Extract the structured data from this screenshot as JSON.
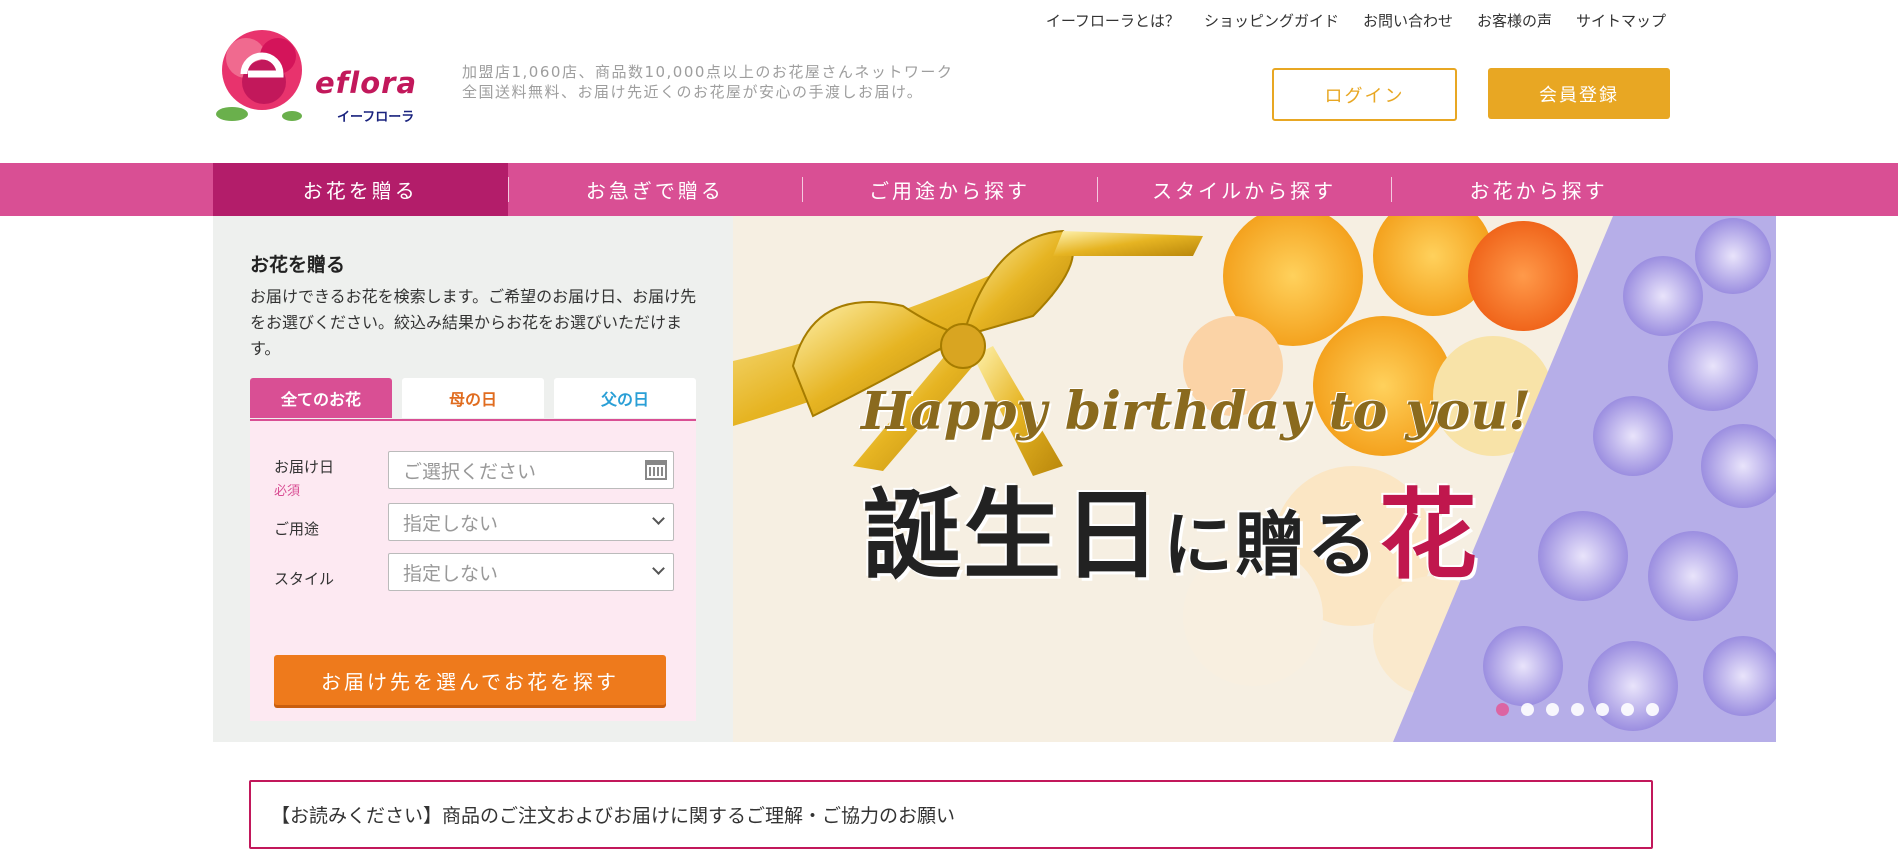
{
  "brand": {
    "name_en": "eflora",
    "name_ja": "イーフローラ",
    "tagline_1": "加盟店1,060店、商品数10,000点以上のお花屋さんネットワーク",
    "tagline_2": "全国送料無料、お届け先近くのお花屋が安心の手渡しお届け。"
  },
  "top_links": [
    "イーフローラとは？",
    "ショッピングガイド",
    "お問い合わせ",
    "お客様の声",
    "サイトマップ"
  ],
  "auth": {
    "login": "ログイン",
    "register": "会員登録"
  },
  "nav": [
    "お花を贈る",
    "お急ぎで贈る",
    "ご用途から探す",
    "スタイルから探す",
    "お花から探す"
  ],
  "search": {
    "title": "お花を贈る",
    "description": "お届けできるお花を検索します。ご希望のお届け日、お届け先をお選びください。絞込み結果からお花をお選びいただけます。",
    "tabs": [
      "全てのお花",
      "母の日",
      "父の日"
    ],
    "date_label": "お届け日",
    "required": "必須",
    "date_placeholder": "ご選択ください",
    "purpose_label": "ご用途",
    "purpose_value": "指定しない",
    "style_label": "スタイル",
    "style_value": "指定しない",
    "submit": "お届け先を選んでお花を探す"
  },
  "banner": {
    "en": "Happy birthday to you!",
    "ja_1": "誕生日",
    "ja_2": "に贈る",
    "ja_3": "花",
    "slide_count": 7,
    "active_slide": 1
  },
  "notice": "【お読みください】商品のご注文およびお届けに関するご理解・ご協力のお願い",
  "colors": {
    "primary": "#d94f94",
    "accent": "#e8a723",
    "cta": "#ee7a1c"
  }
}
